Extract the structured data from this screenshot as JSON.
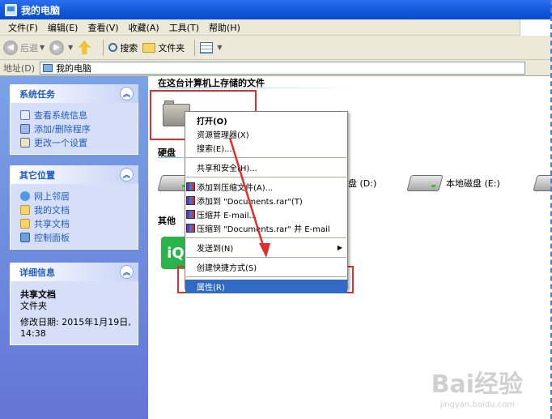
{
  "window": {
    "title": "我的电脑"
  },
  "menu": [
    "文件(F)",
    "编辑(E)",
    "查看(V)",
    "收藏(A)",
    "工具(T)",
    "帮助(H)"
  ],
  "toolbar": {
    "back": "后退",
    "search": "搜索",
    "folders": "文件夹"
  },
  "address": {
    "label": "地址(D)",
    "value": "我的电脑"
  },
  "system_tasks": {
    "title": "系统任务",
    "items": [
      "查看系统信息",
      "添加/删除程序",
      "更改一个设置"
    ]
  },
  "other_places": {
    "title": "其它位置",
    "items": [
      "网上邻居",
      "我的文档",
      "共享文档",
      "控制面板"
    ]
  },
  "details": {
    "title": "详细信息",
    "name": "共享文档",
    "type": "文件夹",
    "modified": "修改日期: 2015年1月19日,",
    "time": "14:38"
  },
  "content": {
    "stored_title": "在这台计算机上存储的文件",
    "hdd_title": "硬盘",
    "other_title": "其他",
    "drive_d": "盘 (D:)",
    "drive_e": "本地磁盘 (E:)",
    "iqiyi_label": "iQ"
  },
  "context_menu": {
    "open": "打开(O)",
    "explorer": "资源管理器(X)",
    "search": "搜索(E)...",
    "share": "共享和安全(H)...",
    "rar_add": "添加到压缩文件(A)...",
    "rar_add_named": "添加到 \"Documents.rar\"(T)",
    "rar_email": "压缩并 E-mail...",
    "rar_email_named": "压缩到 \"Documents.rar\" 并 E-mail",
    "send_to": "发送到(N)",
    "create_shortcut": "创建快捷方式(S)",
    "properties": "属性(R)"
  },
  "watermark": {
    "main": "Bai经验",
    "sub": "jingyan.baidu.com"
  },
  "colors": {
    "highlight_red": "#e0302b",
    "selection_blue": "#316ac5",
    "link_blue": "#215dc6"
  }
}
